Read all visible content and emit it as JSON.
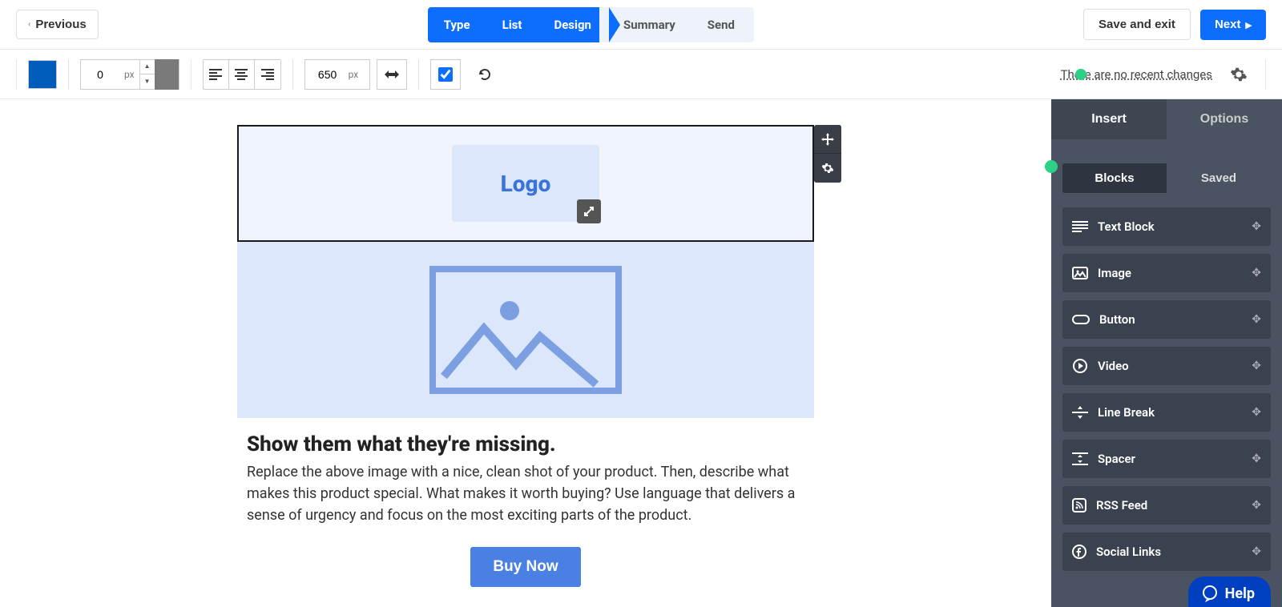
{
  "header": {
    "previous_label": "Previous",
    "wizard_steps": [
      {
        "label": "Type",
        "active": true
      },
      {
        "label": "List",
        "active": true
      },
      {
        "label": "Design",
        "active": true
      },
      {
        "label": "Summary",
        "active": false
      },
      {
        "label": "Send",
        "active": false
      }
    ],
    "save_exit_label": "Save and exit",
    "next_label": "Next"
  },
  "toolbar": {
    "bg_color": "#005bbb",
    "padding_value": "0",
    "padding_unit": "px",
    "width_value": "650",
    "width_unit": "px",
    "changes_text": "There are no recent changes"
  },
  "canvas": {
    "logo_text": "Logo",
    "heading": "Show them what they're missing.",
    "body": "Replace the above image with a nice, clean shot of your product. Then, describe what makes this product special. What makes it worth buying? Use language that delivers a sense of urgency and focus on the most exciting parts of the product.",
    "cta_label": "Buy Now"
  },
  "sidebar": {
    "tabs": {
      "insert": "Insert",
      "options": "Options"
    },
    "sub_tabs": {
      "blocks": "Blocks",
      "saved": "Saved"
    },
    "blocks": [
      {
        "label": "Text Block",
        "icon": "text"
      },
      {
        "label": "Image",
        "icon": "image"
      },
      {
        "label": "Button",
        "icon": "button"
      },
      {
        "label": "Video",
        "icon": "video"
      },
      {
        "label": "Line Break",
        "icon": "line"
      },
      {
        "label": "Spacer",
        "icon": "spacer"
      },
      {
        "label": "RSS Feed",
        "icon": "rss"
      },
      {
        "label": "Social Links",
        "icon": "social"
      }
    ]
  },
  "help": {
    "label": "Help"
  }
}
